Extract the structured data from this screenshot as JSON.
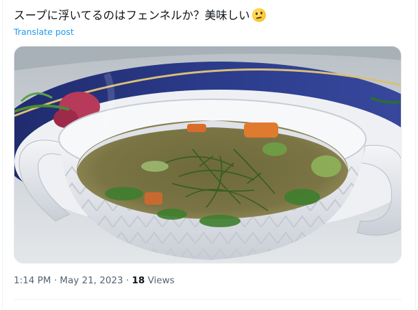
{
  "post": {
    "text": "スープに浮いてるのはフェンネルか？美味しい",
    "emoji": "thinking-face-emoji",
    "translate_label": "Translate post"
  },
  "media": {
    "subject": "soup-bowl-photo"
  },
  "meta": {
    "time": "1:14 PM",
    "separator": "·",
    "date": "May 21, 2023",
    "views_count": "18",
    "views_label": "Views"
  },
  "colors": {
    "link": "#1d9bf0",
    "muted": "#536471",
    "text": "#0f1419",
    "divider": "#eff3f4"
  }
}
